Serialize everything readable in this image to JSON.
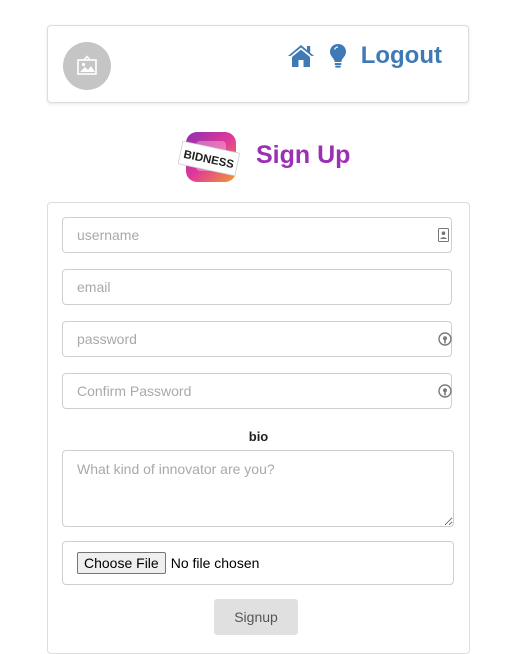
{
  "navbar": {
    "avatar_icon": "image-placeholder-icon",
    "links": [
      {
        "icon": "home-icon"
      },
      {
        "icon": "lightbulb-icon"
      },
      {
        "label": "Logout"
      }
    ],
    "link_color": "#3f7ab6"
  },
  "brand": {
    "logo_text": "BIDNESS",
    "title": "Sign Up",
    "title_color": "#9b30b5"
  },
  "form": {
    "username": {
      "placeholder": "username",
      "icon": "contact-card-icon"
    },
    "email": {
      "placeholder": "email"
    },
    "password": {
      "placeholder": "password",
      "icon": "password-eye-icon"
    },
    "confirm_password": {
      "placeholder": "Confirm Password",
      "icon": "password-eye-icon"
    },
    "bio_label": "bio",
    "bio_placeholder": "What kind of innovator are you?",
    "file_button_label": "Choose File",
    "file_status": "No file chosen",
    "submit_label": "Signup"
  }
}
